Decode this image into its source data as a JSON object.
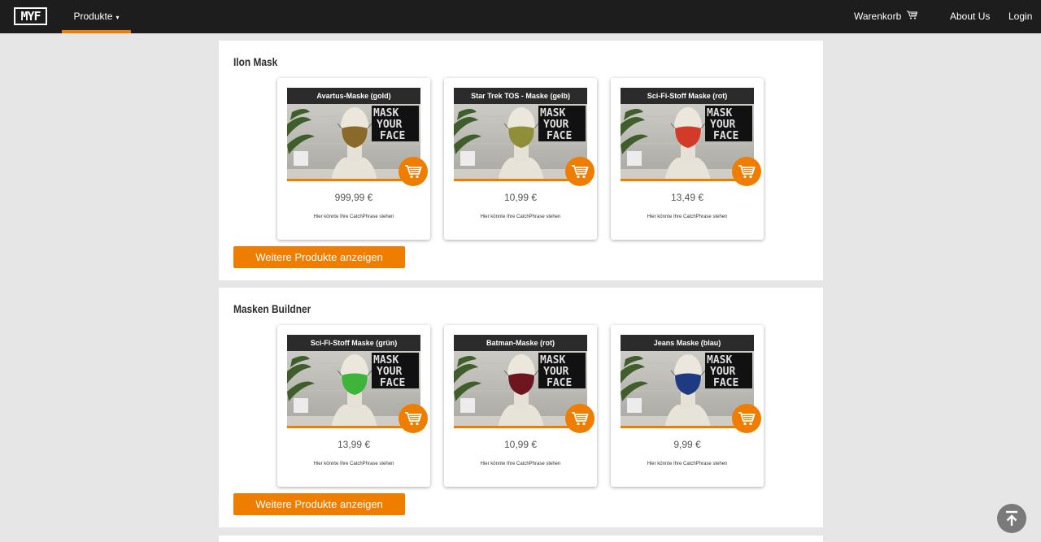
{
  "nav": {
    "logo": "MYF",
    "produkte": "Produkte",
    "caret": "▾",
    "warenkorb": "Warenkorb",
    "about": "About Us",
    "login": "Login"
  },
  "sections": [
    {
      "title": "Ilon Mask",
      "more_label": "Weitere Produkte anzeigen",
      "cards": [
        {
          "name": "Avartus-Maske (gold)",
          "price": "999,99 €",
          "phrase": "Hier könnte Ihre CatchPhrase stehen",
          "mask_color": "#8a6a2a",
          "image_text": "MASK YOUR FACE"
        },
        {
          "name": "Star Trek TOS - Maske (gelb)",
          "price": "10,99 €",
          "phrase": "Hier könnte Ihre CatchPhrase stehen",
          "mask_color": "#8f8f3a",
          "image_text": "MASK YOUR FACE"
        },
        {
          "name": "Sci-Fi-Stoff Maske (rot)",
          "price": "13,49 €",
          "phrase": "Hier könnte Ihre CatchPhrase stehen",
          "mask_color": "#d23b2a",
          "image_text": "MASK YOUR FACE"
        }
      ]
    },
    {
      "title": "Masken Buildner",
      "more_label": "Weitere Produkte anzeigen",
      "cards": [
        {
          "name": "Sci-Fi-Stoff Maske (grün)",
          "price": "13,99 €",
          "phrase": "Hier könnte Ihre CatchPhrase stehen",
          "mask_color": "#3fb43a",
          "image_text": "MASK YOUR FACE"
        },
        {
          "name": "Batman-Maske (rot)",
          "price": "10,99 €",
          "phrase": "Hier könnte Ihre CatchPhrase stehen",
          "mask_color": "#6e1620",
          "image_text": "MASK YOUR FACE"
        },
        {
          "name": "Jeans Maske (blau)",
          "price": "9,99 €",
          "phrase": "Hier könnte Ihre CatchPhrase stehen",
          "mask_color": "#1e3a80",
          "image_text": "MASK YOUR FACE"
        }
      ]
    }
  ],
  "colors": {
    "accent": "#ef7d00",
    "navbar": "#1d1d1d",
    "page_bg": "#e6e6e6"
  }
}
